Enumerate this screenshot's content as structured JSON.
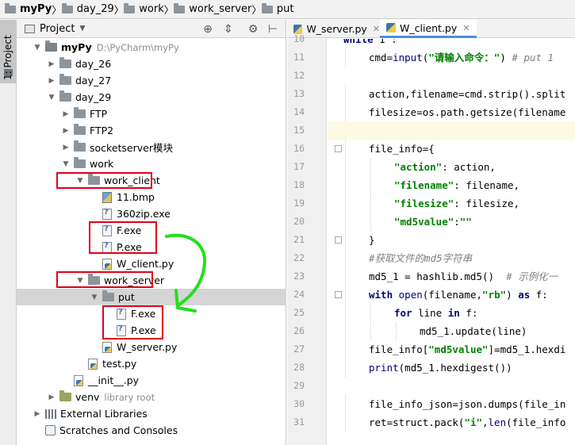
{
  "breadcrumb": [
    {
      "label": "myPy",
      "bold": true
    },
    {
      "label": "day_29",
      "bold": false
    },
    {
      "label": "work",
      "bold": false
    },
    {
      "label": "work_server",
      "bold": false
    },
    {
      "label": "put",
      "bold": false
    }
  ],
  "tool_strip": {
    "project_label": "1: Project"
  },
  "project_panel": {
    "title": "Project",
    "tree": [
      {
        "label": "myPy",
        "hint": "D:\\PyCharm\\myPy",
        "kind": "root",
        "depth": 0,
        "arrow": "down"
      },
      {
        "label": "day_26",
        "kind": "folder",
        "depth": 1,
        "arrow": "right"
      },
      {
        "label": "day_27",
        "kind": "folder",
        "depth": 1,
        "arrow": "right"
      },
      {
        "label": "day_29",
        "kind": "folder",
        "depth": 1,
        "arrow": "down"
      },
      {
        "label": "FTP",
        "kind": "folder",
        "depth": 2,
        "arrow": "right"
      },
      {
        "label": "FTP2",
        "kind": "folder",
        "depth": 2,
        "arrow": "right"
      },
      {
        "label": "socketserver模块",
        "kind": "folder",
        "depth": 2,
        "arrow": "right"
      },
      {
        "label": "work",
        "kind": "folder",
        "depth": 2,
        "arrow": "down"
      },
      {
        "label": "work_client",
        "kind": "folder",
        "depth": 3,
        "arrow": "down"
      },
      {
        "label": "11.bmp",
        "kind": "bmp",
        "depth": 4,
        "arrow": "none"
      },
      {
        "label": "360zip.exe",
        "kind": "exe",
        "depth": 4,
        "arrow": "none"
      },
      {
        "label": "F.exe",
        "kind": "exe",
        "depth": 4,
        "arrow": "none"
      },
      {
        "label": "P.exe",
        "kind": "exe",
        "depth": 4,
        "arrow": "none"
      },
      {
        "label": "W_client.py",
        "kind": "py",
        "depth": 4,
        "arrow": "none"
      },
      {
        "label": "work_server",
        "kind": "folder",
        "depth": 3,
        "arrow": "down"
      },
      {
        "label": "put",
        "kind": "folder",
        "depth": 4,
        "arrow": "down",
        "selected": true
      },
      {
        "label": "F.exe",
        "kind": "exe",
        "depth": 5,
        "arrow": "none"
      },
      {
        "label": "P.exe",
        "kind": "exe",
        "depth": 5,
        "arrow": "none"
      },
      {
        "label": "W_server.py",
        "kind": "py",
        "depth": 4,
        "arrow": "none"
      },
      {
        "label": "test.py",
        "kind": "py",
        "depth": 3,
        "arrow": "none"
      },
      {
        "label": "__init__.py",
        "kind": "py",
        "depth": 2,
        "arrow": "none"
      },
      {
        "label": "venv",
        "hint": "library root",
        "kind": "venv",
        "depth": 1,
        "arrow": "right"
      },
      {
        "label": "External Libraries",
        "kind": "lib",
        "depth": 0,
        "arrow": "right"
      },
      {
        "label": "Scratches and Consoles",
        "kind": "scratch",
        "depth": 0,
        "arrow": "none"
      }
    ]
  },
  "editor": {
    "tabs": [
      {
        "label": "W_server.py",
        "active": false
      },
      {
        "label": "W_client.py",
        "active": true
      }
    ],
    "current_line": 15,
    "lines": [
      {
        "n": "10",
        "indent": 0,
        "segs": [
          [
            "kw",
            "while "
          ],
          [
            "num",
            "1"
          ],
          [
            "plain",
            " :"
          ]
        ]
      },
      {
        "n": "11",
        "indent": 1,
        "segs": [
          [
            "plain",
            "cmd="
          ],
          [
            "fn",
            "input"
          ],
          [
            "plain",
            "("
          ],
          [
            "str",
            "\"请输入命令：\""
          ],
          [
            "plain",
            ") "
          ],
          [
            "cm",
            "# put 1"
          ]
        ]
      },
      {
        "n": "12",
        "indent": 0,
        "segs": []
      },
      {
        "n": "13",
        "indent": 1,
        "segs": [
          [
            "plain",
            "action,filename=cmd.strip().split"
          ]
        ]
      },
      {
        "n": "14",
        "indent": 1,
        "segs": [
          [
            "plain",
            "filesize=os.path.getsize(filename"
          ]
        ]
      },
      {
        "n": "15",
        "indent": 0,
        "segs": []
      },
      {
        "n": "16",
        "indent": 1,
        "segs": [
          [
            "plain",
            "file_info={"
          ]
        ]
      },
      {
        "n": "17",
        "indent": 2,
        "segs": [
          [
            "str",
            "\"action\""
          ],
          [
            "plain",
            ": action,"
          ]
        ]
      },
      {
        "n": "18",
        "indent": 2,
        "segs": [
          [
            "str",
            "\"filename\""
          ],
          [
            "plain",
            ": filename,"
          ]
        ]
      },
      {
        "n": "19",
        "indent": 2,
        "segs": [
          [
            "str",
            "\"filesize\""
          ],
          [
            "plain",
            ": filesize,"
          ]
        ]
      },
      {
        "n": "20",
        "indent": 2,
        "segs": [
          [
            "str",
            "\"md5value\""
          ],
          [
            "plain",
            ":"
          ],
          [
            "str",
            "\"\""
          ]
        ]
      },
      {
        "n": "21",
        "indent": 1,
        "segs": [
          [
            "plain",
            "}"
          ]
        ]
      },
      {
        "n": "22",
        "indent": 1,
        "segs": [
          [
            "cm",
            "#获取文件的md5字符串"
          ]
        ]
      },
      {
        "n": "23",
        "indent": 1,
        "segs": [
          [
            "plain",
            "md5_1 = hashlib.md5()  "
          ],
          [
            "cm",
            "# 示例化一"
          ]
        ]
      },
      {
        "n": "24",
        "indent": 1,
        "segs": [
          [
            "kw",
            "with "
          ],
          [
            "fn",
            "open"
          ],
          [
            "plain",
            "(filename,"
          ],
          [
            "str",
            "\"rb\""
          ],
          [
            "plain",
            ") "
          ],
          [
            "kw",
            "as"
          ],
          [
            "plain",
            " f:"
          ]
        ]
      },
      {
        "n": "25",
        "indent": 2,
        "segs": [
          [
            "kw",
            "for"
          ],
          [
            "plain",
            " line "
          ],
          [
            "kw",
            "in"
          ],
          [
            "plain",
            " f:"
          ]
        ]
      },
      {
        "n": "26",
        "indent": 3,
        "segs": [
          [
            "plain",
            "md5_1.update(line)"
          ]
        ]
      },
      {
        "n": "27",
        "indent": 1,
        "segs": [
          [
            "plain",
            "file_info["
          ],
          [
            "str",
            "\"md5value\""
          ],
          [
            "plain",
            "]=md5_1.hexdi"
          ]
        ]
      },
      {
        "n": "28",
        "indent": 1,
        "segs": [
          [
            "fn",
            "print"
          ],
          [
            "plain",
            "(md5_1.hexdigest())"
          ]
        ]
      },
      {
        "n": "29",
        "indent": 0,
        "segs": []
      },
      {
        "n": "30",
        "indent": 1,
        "segs": [
          [
            "plain",
            "file_info_json=json.dumps(file_in"
          ]
        ]
      },
      {
        "n": "31",
        "indent": 1,
        "segs": [
          [
            "plain",
            "ret=struct.pack("
          ],
          [
            "str",
            "\"i\""
          ],
          [
            "plain",
            ","
          ],
          [
            "fn",
            "len"
          ],
          [
            "plain",
            "(file_info"
          ]
        ]
      }
    ]
  },
  "annotations": {
    "box_color": "#e0001b",
    "arrow_color": "#22e01b"
  }
}
